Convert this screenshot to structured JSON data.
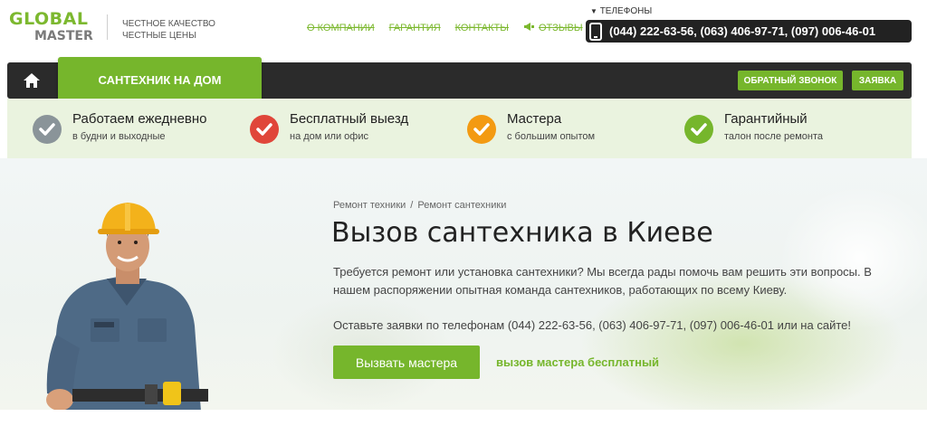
{
  "logo": {
    "line1": "GLOBAL",
    "line2": "MASTER"
  },
  "tagline": {
    "line1": "ЧЕСТНОЕ КАЧЕСТВО",
    "line2": "ЧЕСТНЫЕ ЦЕНЫ"
  },
  "nav": {
    "items": [
      {
        "label": "О КОМПАНИИ"
      },
      {
        "label": "ГАРАНТИЯ"
      },
      {
        "label": "КОНТАКТЫ"
      },
      {
        "label": "ОТЗЫВЫ",
        "icon": "megaphone-icon"
      }
    ]
  },
  "phones": {
    "label": "ТЕЛЕФОНЫ",
    "numbers": "(044) 222-63-56, (063) 406-97-71, (097) 006-46-01"
  },
  "menu": {
    "active_tab": "САНТЕХНИК НА ДОМ",
    "callback": "ОБРАТНЫЙ ЗВОНОК",
    "request": "ЗАЯВКА",
    "home_icon": "home-icon"
  },
  "features": [
    {
      "title": "Работаем ежедневно",
      "subtitle": "в будни и выходные",
      "color": "#8a9499"
    },
    {
      "title": "Бесплатный выезд",
      "subtitle": "на дом или офис",
      "color": "#e0463a"
    },
    {
      "title": "Мастера",
      "subtitle": "с большим опытом",
      "color": "#f39a12"
    },
    {
      "title": "Гарантийный",
      "subtitle": "талон после ремонта",
      "color": "#76b62c"
    }
  ],
  "breadcrumb": {
    "items": [
      "Ремонт техники",
      "Ремонт сантехники"
    ],
    "separator": "/"
  },
  "hero": {
    "title": "Вызов сантехника в Киеве",
    "lead": "Требуется ремонт или установка сантехники? Мы всегда рады помочь вам решить эти вопросы. В нашем распоряжении опытная команда сантехников, работающих по всему Киеву.",
    "call_line": "Оставьте заявки по телефонам (044) 222-63-56, (063) 406-97-71, (097) 006-46-01 или на сайте!",
    "cta": "Вызвать мастера",
    "cta_note": "вызов мастера бесплатный"
  },
  "colors": {
    "accent": "#76b62c",
    "dark": "#2b2b2b",
    "strip": "#eaf3df"
  }
}
